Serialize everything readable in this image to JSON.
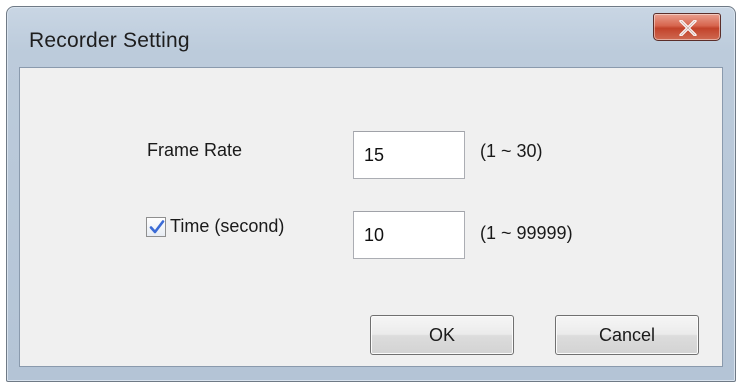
{
  "window": {
    "title": "Recorder Setting",
    "close_icon": "close-x-icon"
  },
  "frame_rate": {
    "label": "Frame Rate",
    "value": "15",
    "range": "(1 ~ 30)"
  },
  "time": {
    "checked": true,
    "label": "Time (second)",
    "value": "10",
    "range": "(1 ~ 99999)"
  },
  "buttons": {
    "ok_label": "OK",
    "cancel_label": "Cancel"
  },
  "colors": {
    "close_button": "#c9452d",
    "frame": "#bccbdb",
    "client_bg": "#f0f0f0",
    "checkmark": "#3b6bd6"
  }
}
